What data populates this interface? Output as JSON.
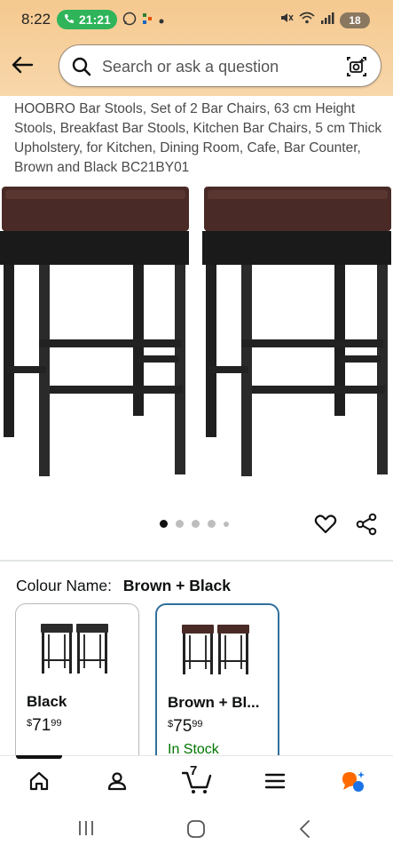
{
  "status_bar": {
    "time": "8:22",
    "call_time": "21:21",
    "battery": "18"
  },
  "search": {
    "placeholder": "Search or ask a question"
  },
  "product": {
    "title": "HOOBRO Bar Stools, Set of 2 Bar Chairs, 63 cm Height Stools, Breakfast Bar Stools, Kitchen Bar Chairs, 5 cm Thick Upholstery, for Kitchen, Dining Room, Cafe, Bar Counter, Brown and Black BC21BY01",
    "image_count": 5,
    "active_image": 1
  },
  "colour": {
    "label": "Colour Name:",
    "selected": "Brown + Black",
    "options": [
      {
        "name": "Black",
        "currency": "$",
        "whole": "71",
        "fraction": "99",
        "stock": "",
        "seat_color": "#2b2b2b"
      },
      {
        "name": "Brown + Bl...",
        "currency": "$",
        "whole": "75",
        "fraction": "99",
        "stock": "In Stock",
        "seat_color": "#4a2a26"
      }
    ]
  },
  "bottom_nav": {
    "cart_count": "7",
    "items": [
      "home-icon",
      "account-icon",
      "cart-icon",
      "menu-icon",
      "rufus-icon"
    ]
  },
  "colors": {
    "header_bg": "#f5c98f",
    "accent_blue": "#2f6f9a",
    "in_stock_green": "#007600",
    "seat_brown": "#4a2a26"
  }
}
